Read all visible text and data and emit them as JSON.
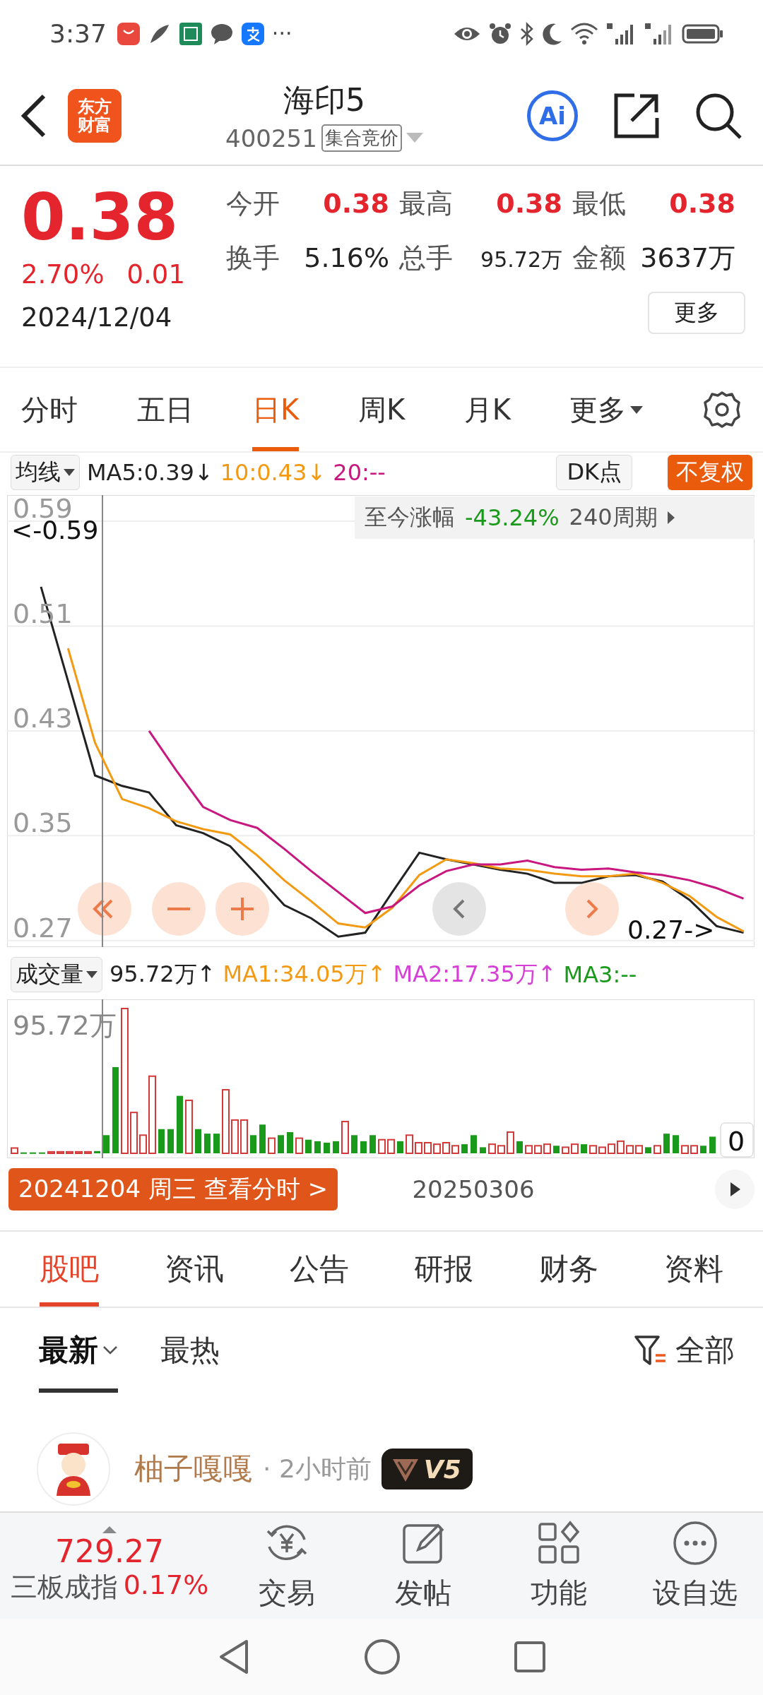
{
  "status_bar": {
    "time": "3:37",
    "more": "···"
  },
  "header": {
    "logo_lines": [
      "东方",
      "财富"
    ],
    "title": "海印5",
    "code": "400251",
    "tag": "集合竞价",
    "ai_label": "Ai"
  },
  "quote": {
    "price": "0.38",
    "change_pct": "2.70%",
    "change": "0.01",
    "date": "2024/12/04",
    "more": "更多",
    "stats": [
      {
        "label": "今开",
        "value": "0.38",
        "kind": "price"
      },
      {
        "label": "最高",
        "value": "0.38",
        "kind": "price"
      },
      {
        "label": "最低",
        "value": "0.38",
        "kind": "price"
      },
      {
        "label": "换手",
        "value": "5.16%",
        "kind": "plain"
      },
      {
        "label": "总手",
        "value": "95.72万",
        "kind": "small"
      },
      {
        "label": "金额",
        "value": "3637万",
        "kind": "plain"
      }
    ]
  },
  "period_tabs": [
    {
      "label": "分时",
      "selected": false,
      "dropdown": false
    },
    {
      "label": "五日",
      "selected": false,
      "dropdown": false
    },
    {
      "label": "日K",
      "selected": true,
      "dropdown": false
    },
    {
      "label": "周K",
      "selected": false,
      "dropdown": false
    },
    {
      "label": "月K",
      "selected": false,
      "dropdown": false
    },
    {
      "label": "更多",
      "selected": false,
      "dropdown": true
    }
  ],
  "indicator_bar": {
    "selector": "均线",
    "items": [
      {
        "text": "MA5:0.39↓",
        "color": "#222222"
      },
      {
        "text": "10:0.43↓",
        "color": "#f39a12"
      },
      {
        "text": "20:--",
        "color": "#c8177f"
      }
    ],
    "dk": "DK点",
    "adjust": "不复权"
  },
  "kline": {
    "marker_high": "<-0.59",
    "marker_low": "0.27->",
    "range_label": "至今涨幅",
    "range_value": "-43.24%",
    "range_period": "240周期",
    "chart_data": {
      "type": "line",
      "grid": true,
      "ylim": [
        0.265,
        0.61
      ],
      "yticks": [
        0.59,
        0.51,
        0.43,
        0.35,
        0.27
      ],
      "series": [
        {
          "color": "#222222",
          "values": [
            0.54,
            0.468,
            0.396,
            0.388,
            0.383,
            0.358,
            0.352,
            0.342,
            0.32,
            0.297,
            0.287,
            0.273,
            0.276,
            0.307,
            0.337,
            0.332,
            0.328,
            0.324,
            0.321,
            0.314,
            0.314,
            0.319,
            0.32,
            0.315,
            0.301,
            0.281,
            0.276
          ]
        },
        {
          "color": "#f39a12",
          "values": [
            null,
            0.493,
            0.421,
            0.378,
            0.371,
            0.361,
            0.355,
            0.351,
            0.335,
            0.316,
            0.3,
            0.283,
            0.28,
            0.295,
            0.32,
            0.332,
            0.329,
            0.325,
            0.324,
            0.321,
            0.319,
            0.319,
            0.321,
            0.314,
            0.304,
            0.288,
            0.277
          ]
        },
        {
          "color": "#c8177f",
          "values": [
            null,
            null,
            null,
            null,
            0.43,
            0.4,
            0.372,
            0.362,
            0.356,
            0.34,
            0.323,
            0.307,
            0.291,
            0.296,
            0.312,
            0.323,
            0.328,
            0.328,
            0.331,
            0.326,
            0.324,
            0.325,
            0.322,
            0.32,
            0.316,
            0.31,
            0.302
          ]
        }
      ]
    }
  },
  "volume": {
    "selector": "成交量",
    "current": "95.72万↑",
    "items": [
      {
        "text": "MA1:34.05万↑",
        "color": "#f39a12"
      },
      {
        "text": "MA2:17.35万↑",
        "color": "#d63fd6"
      },
      {
        "text": "MA3:--",
        "color": "#1a9a1a"
      }
    ],
    "max_label": "95.72万",
    "min_label": "0"
  },
  "date_bar": {
    "button": "20241204 周三 查看分时 >",
    "date": "20250306"
  },
  "content_tabs": [
    {
      "label": "股吧",
      "selected": true
    },
    {
      "label": "资讯",
      "selected": false
    },
    {
      "label": "公告",
      "selected": false
    },
    {
      "label": "研报",
      "selected": false
    },
    {
      "label": "财务",
      "selected": false
    },
    {
      "label": "资料",
      "selected": false
    }
  ],
  "sort_tabs": [
    {
      "label": "最新",
      "selected": true,
      "dropdown": true
    },
    {
      "label": "最热",
      "selected": false,
      "dropdown": false
    }
  ],
  "filter": "全部",
  "post": {
    "author": "柚子嘎嘎",
    "time": "· 2小时前",
    "badge": "V5"
  },
  "bottom_bar": {
    "index_value": "729.27",
    "index_name": "三板成指",
    "index_change": "0.17%",
    "actions": [
      {
        "label": "交易",
        "kind": "trade"
      },
      {
        "label": "发帖",
        "kind": "post"
      },
      {
        "label": "功能",
        "kind": "apps"
      },
      {
        "label": "设自选",
        "kind": "more"
      }
    ]
  }
}
